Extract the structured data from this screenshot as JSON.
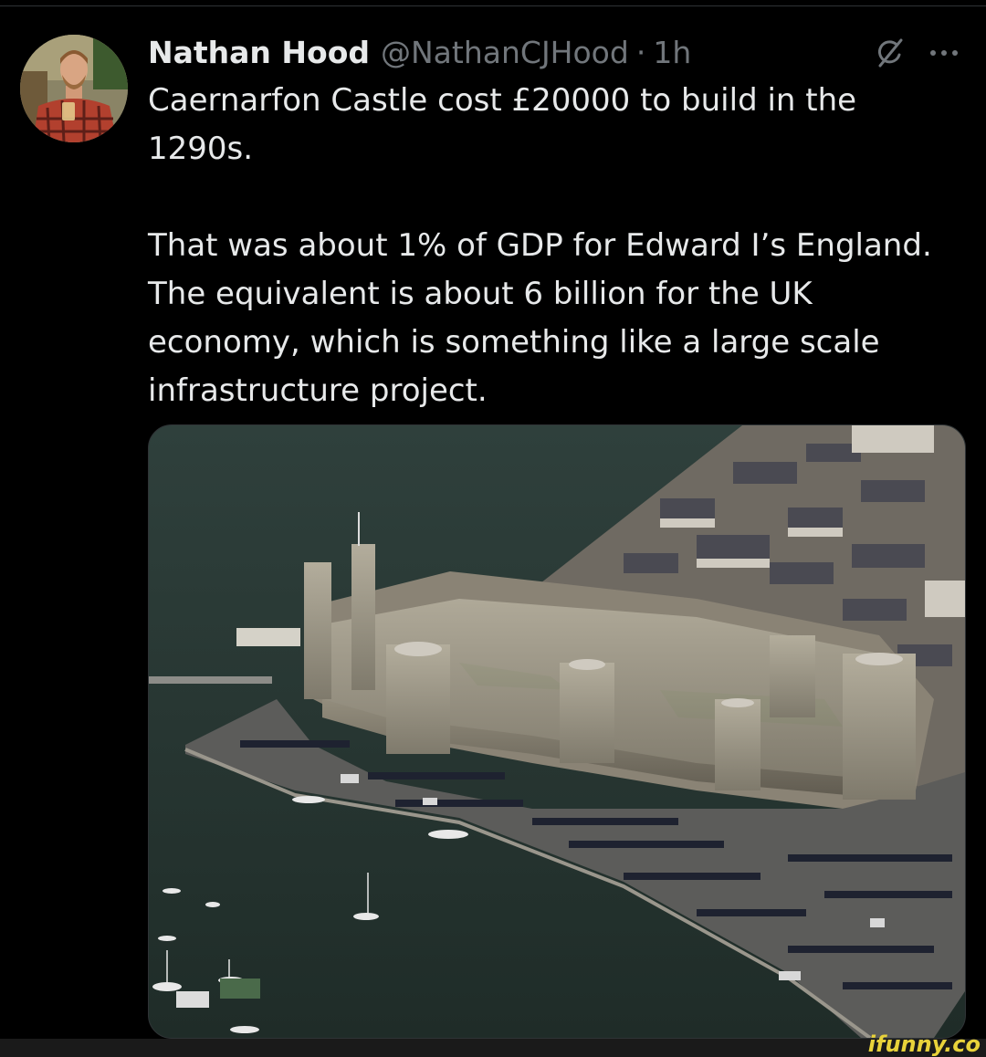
{
  "tweet": {
    "author_name": "Nathan Hood",
    "author_handle": "@NathanCJHood",
    "separator": "·",
    "timestamp": "1h",
    "text": "Caernarfon Castle cost £20000 to build in the 1290s.\n\nThat was about 1% of GDP for Edward I’s England. The equivalent is about 6 billion for the UK economy, which is something like a large scale infrastructure project."
  },
  "icons": {
    "grok": "grok-icon",
    "more": "more-options-icon",
    "avatar": "avatar-photo"
  },
  "watermark": {
    "text": "ifunny.co"
  },
  "colors": {
    "background": "#000000",
    "text_primary": "#e7e9ea",
    "text_secondary": "#71767b",
    "watermark": "#e8d23a"
  }
}
